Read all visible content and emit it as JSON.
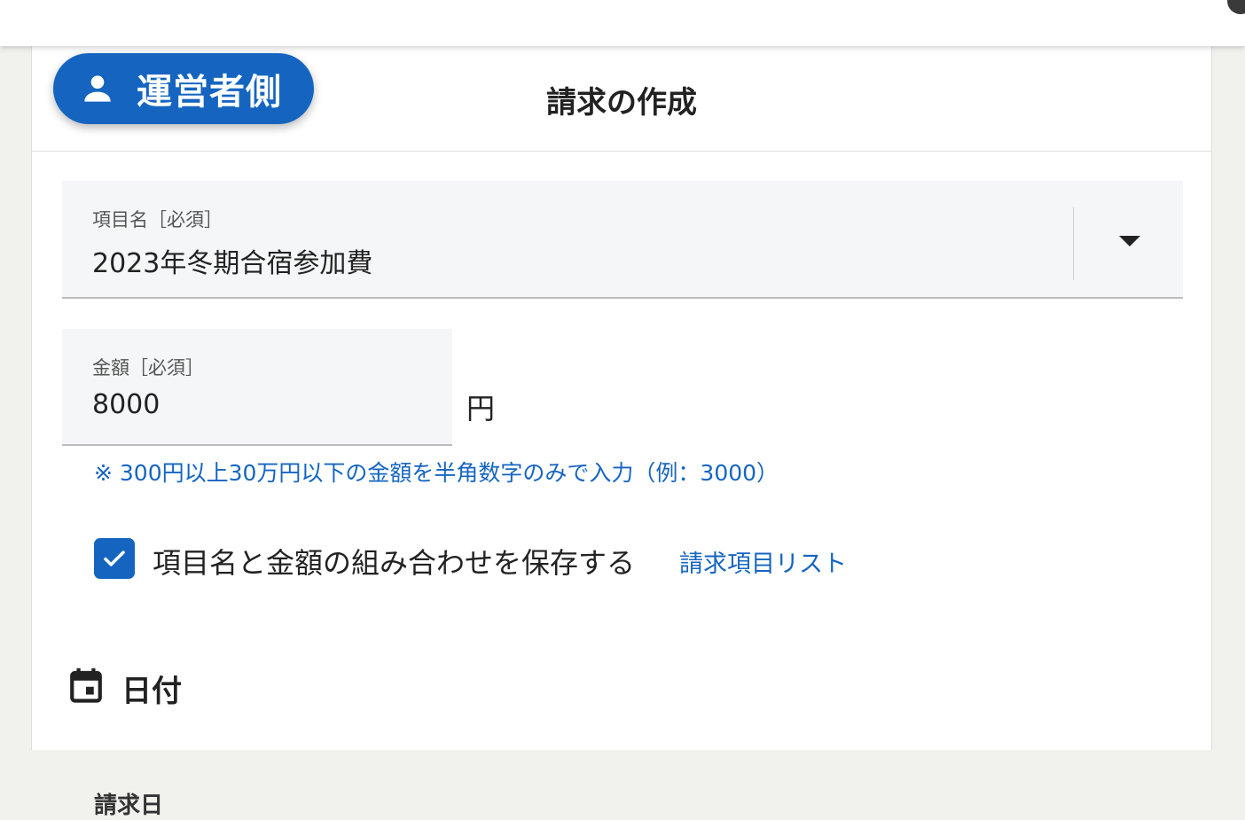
{
  "role_badge": {
    "icon": "person-icon",
    "label": "運営者側",
    "color": "#1565c0"
  },
  "header": {
    "title": "請求の作成"
  },
  "item_field": {
    "label": "項目名［必須］",
    "value": "2023年冬期合宿参加費",
    "dropdown_icon": "caret-down-icon"
  },
  "amount_field": {
    "label": "金額［必須］",
    "value": "8000",
    "unit": "円"
  },
  "hint": "※ 300円以上30万円以下の金額を半角数字のみで入力（例：3000）",
  "save_combo": {
    "checked": true,
    "label": "項目名と金額の組み合わせを保存する",
    "link_label": "請求項目リスト"
  },
  "date_section": {
    "icon": "calendar-icon",
    "title": "日付",
    "next_label": "請求日"
  },
  "colors": {
    "accent": "#1565c0",
    "field_bg": "#f5f6f7",
    "page_bg": "#f1f1ee"
  }
}
